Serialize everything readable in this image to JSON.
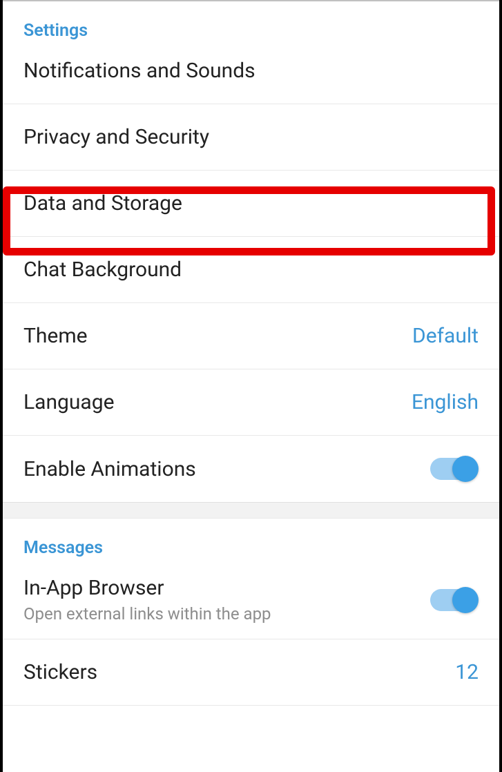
{
  "settings": {
    "header": "Settings",
    "items": {
      "notifications": "Notifications and Sounds",
      "privacy": "Privacy and Security",
      "data_storage": "Data and Storage",
      "chat_background": "Chat Background",
      "theme_label": "Theme",
      "theme_value": "Default",
      "language_label": "Language",
      "language_value": "English",
      "animations_label": "Enable Animations"
    }
  },
  "messages": {
    "header": "Messages",
    "items": {
      "browser_label": "In-App Browser",
      "browser_subtitle": "Open external links within the app",
      "stickers_label": "Stickers",
      "stickers_value": "12"
    }
  }
}
